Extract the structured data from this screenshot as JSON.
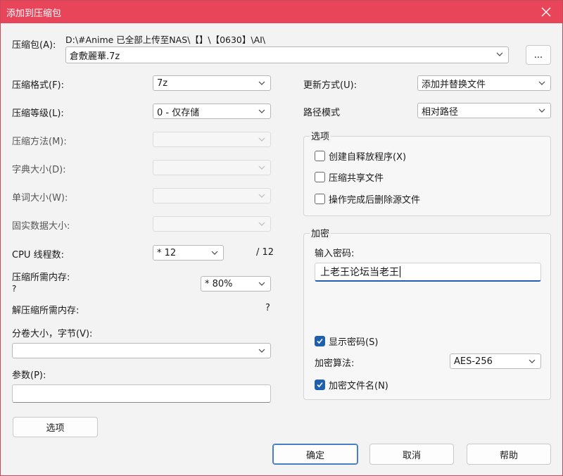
{
  "window": {
    "title": "添加到压缩包"
  },
  "archive": {
    "label": "压缩包(A):",
    "path": "D:\\#Anime 已全部上传至NAS\\【】\\【0630】\\AI\\",
    "filename": "倉敷麗華.7z",
    "browse_label": "..."
  },
  "left": {
    "format_label": "压缩格式(F):",
    "format_value": "7z",
    "level_label": "压缩等级(L):",
    "level_value": "0 - 仅存储",
    "method_label": "压缩方法(M):",
    "dict_label": "字典大小(D):",
    "word_label": "单词大小(W):",
    "solid_label": "固实数据大小:",
    "threads_label": "CPU 线程数:",
    "threads_value": "* 12",
    "threads_max": "/ 12",
    "mem_label": "压缩所需内存:",
    "mem_q": "?",
    "mem_value": "* 80%",
    "decomp_mem_label": "解压缩所需内存:",
    "decomp_mem_value": "?",
    "volume_label": "分卷大小，字节(V):",
    "volume_value": "",
    "params_label": "参数(P):",
    "params_value": "",
    "options_button": "选项"
  },
  "right": {
    "update_label": "更新方式(U):",
    "update_value": "添加并替换文件",
    "path_label": "路径模式",
    "path_value": "相对路径",
    "options_group": {
      "title": "选项",
      "items": [
        {
          "label": "创建自释放程序(X)",
          "checked": false
        },
        {
          "label": "压缩共享文件",
          "checked": false
        },
        {
          "label": "操作完成后删除源文件",
          "checked": false
        }
      ]
    },
    "encrypt_group": {
      "title": "加密",
      "password_label": "输入密码:",
      "password_value": "上老王论坛当老王",
      "show_password_label": "显示密码(S)",
      "show_password_checked": true,
      "algo_label": "加密算法:",
      "algo_value": "AES-256",
      "encrypt_names_label": "加密文件名(N)",
      "encrypt_names_checked": true
    }
  },
  "footer": {
    "ok": "确定",
    "cancel": "取消",
    "help": "帮助"
  },
  "colors": {
    "titlebar": "#e8445a",
    "accent": "#1f5fb0"
  }
}
